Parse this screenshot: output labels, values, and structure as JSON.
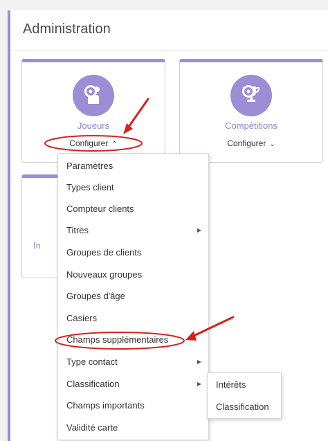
{
  "panel": {
    "title": "Administration"
  },
  "cards": [
    {
      "name": "Joueurs",
      "configure": "Configurer",
      "icon": "people-icon",
      "chevron": "⌃"
    },
    {
      "name": "Compétitions",
      "configure": "Configurer",
      "icon": "trophy-icon",
      "chevron": "⌄"
    },
    {
      "name_partial": "In"
    }
  ],
  "dropdown": {
    "items": [
      {
        "label": "Paramètres",
        "has_submenu": false
      },
      {
        "label": "Types client",
        "has_submenu": false
      },
      {
        "label": "Compteur clients",
        "has_submenu": false
      },
      {
        "label": "Titres",
        "has_submenu": true
      },
      {
        "label": "Groupes de clients",
        "has_submenu": false
      },
      {
        "label": "Nouveaux groupes",
        "has_submenu": false
      },
      {
        "label": "Groupes d'âge",
        "has_submenu": false
      },
      {
        "label": "Casiers",
        "has_submenu": false
      },
      {
        "label": "Champs supplémentaires",
        "has_submenu": false
      },
      {
        "label": "Type contact",
        "has_submenu": true
      },
      {
        "label": "Classification",
        "has_submenu": true
      },
      {
        "label": "Champs importants",
        "has_submenu": false
      },
      {
        "label": "Validité carte",
        "has_submenu": false
      }
    ]
  },
  "submenu": {
    "items": [
      {
        "label": "Intérêts"
      },
      {
        "label": "Classification"
      }
    ]
  },
  "colors": {
    "accent": "#9b8dd6",
    "annotation": "#d9201f"
  }
}
